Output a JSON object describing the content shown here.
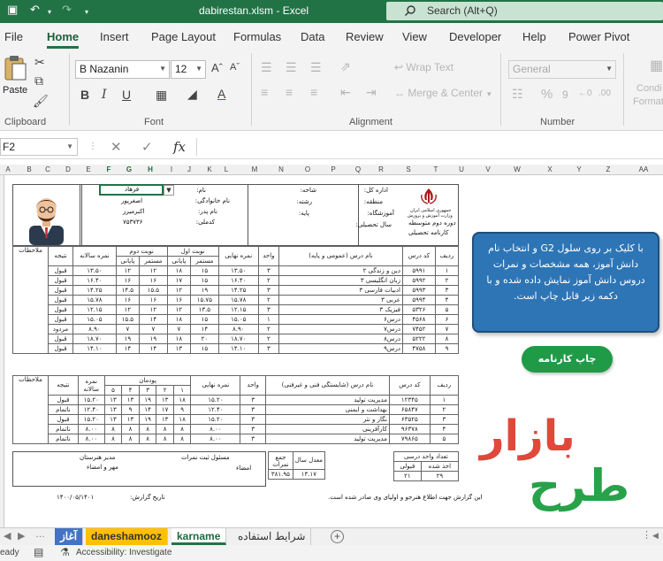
{
  "window": {
    "title": "dabirestan.xlsm  -  Excel",
    "search_text": "Search (Alt+Q)"
  },
  "menu": [
    "File",
    "Home",
    "Insert",
    "Page Layout",
    "Formulas",
    "Data",
    "Review",
    "View",
    "Developer",
    "Help",
    "Power Pivot"
  ],
  "ribbon": {
    "paste_label": "Paste",
    "clipboard_label": "Clipboard",
    "font_name": "B Nazanin",
    "font_size": "12",
    "font_label": "Font",
    "wrap_text": "Wrap Text",
    "merge_center": "Merge & Center",
    "alignment_label": "Alignment",
    "number_format": "General",
    "number_label": "Number",
    "cond_format_1": "Condi",
    "cond_format_2": "Format"
  },
  "formula_bar": {
    "name_box": "F2",
    "fx": "fx"
  },
  "columns": [
    "A",
    "B",
    "C",
    "D",
    "E",
    "F",
    "G",
    "H",
    "I",
    "J",
    "K",
    "L",
    "M",
    "N",
    "O",
    "P",
    "Q",
    "R",
    "S",
    "T",
    "U",
    "V",
    "W",
    "X",
    "Y",
    "Z",
    "AA"
  ],
  "header": {
    "emblem_line1": "جمهوری اسلامی ایران",
    "emblem_line2": "وزارت آموزش و پرورش",
    "school_stage": "دوره دوم متوسطه",
    "report_title": "کارنامه تحصیلی",
    "label_province": "اداره کل:",
    "label_region": "منطقه:",
    "label_school": "آموزشگاه:",
    "label_year": "سال تحصیلی:",
    "label_branch": "شاخه:",
    "label_field": "رشته:",
    "label_grade": "پایه:",
    "label_name": "نام:",
    "label_family": "نام خانوادگی:",
    "label_father": "نام پدر:",
    "label_code": "کدملی:",
    "student_name": "فرهاد",
    "student_family": "اصغرپور",
    "student_father": "اکبرمیرز",
    "student_code": "۷۵۳۷۳۶"
  },
  "table1": {
    "headers": {
      "row": "ردیف",
      "code": "کد درس",
      "name": "نام درس (عمومی و پایه)",
      "unit": "واحد",
      "final": "نمره نهایی",
      "term1": "نوبت اول",
      "term2": "نوبت دوم",
      "continuous": "مستمر",
      "final_exam": "پایانی",
      "yearly": "نمره سالانه",
      "result": "نتیجه",
      "notes": "ملاحظات"
    },
    "rows": [
      [
        "۱",
        "۵۹۹۱",
        "دین و زندگی ۲",
        "۳",
        "۱۳.۵۰",
        "۱۵",
        "۱۸",
        "۱۲",
        "۱۲",
        "۱۳.۵۰",
        "قبول"
      ],
      [
        "۲",
        "۵۹۹۲",
        "زبان انگلیسی ۳",
        "۲",
        "۱۶.۴۰",
        "۱۵",
        "۱۷",
        "۱۶",
        "۱۶",
        "۱۶.۴۰",
        "قبول"
      ],
      [
        "۳",
        "۵۹۹۳",
        "ادبیات فارسی ۳",
        "۳",
        "۱۴.۲۵",
        "۱۹",
        "۱۲",
        "۱۵.۵",
        "۱۴.۵",
        "۱۴.۲۵",
        "قبول"
      ],
      [
        "۴",
        "۵۹۹۴",
        "عربی ۳",
        "۲",
        "۱۵.۷۸",
        "۱۵.۷۵",
        "۱۶",
        "۱۶",
        "۱۶",
        "۱۵.۷۸",
        "قبول"
      ],
      [
        "۵",
        "۵۳۲۶",
        "فیزیک ۳",
        "۳",
        "۱۲.۱۵",
        "۱۳.۵",
        "۱۲",
        "۱۲",
        "۱۲",
        "۱۲.۱۵",
        "قبول"
      ],
      [
        "۶",
        "۴۵۶۸",
        "درس۶",
        "۱",
        "۱۵.۰۵",
        "۱۵",
        "۱۸",
        "۱۴",
        "۱۵.۵",
        "۱۵.۰۵",
        "قبول"
      ],
      [
        "۷",
        "۷۴۵۲",
        "درس۷",
        "۲",
        "۸.۹۰",
        "۱۴",
        "۷",
        "۷",
        "۷",
        "۸.۹۰",
        "مردود"
      ],
      [
        "۸",
        "۵۲۲۲",
        "درس۸",
        "۲",
        "۱۸.۷۰",
        "۲۰",
        "۱۸",
        "۱۹",
        "۱۹",
        "۱۸.۷۰",
        "قبول"
      ],
      [
        "۹",
        "۴۷۵۸",
        "درس۹",
        "۳",
        "۱۴.۱۰",
        "۱۵",
        "۱۳",
        "۱۴",
        "۱۴",
        "۱۴.۱۰",
        "قبول"
      ]
    ]
  },
  "table2": {
    "headers": {
      "row": "ردیف",
      "code": "کد درس",
      "name": "نام درس (شایستگی فنی و غیرفنی)",
      "unit": "واحد",
      "final": "نمره نهایی",
      "modules": "پودمان",
      "m1": "۱",
      "m2": "۲",
      "m3": "۳",
      "m4": "۴",
      "m5": "۵",
      "yearly": "نمره سالانه",
      "result": "نتیجه",
      "notes": "ملاحظات"
    },
    "rows": [
      [
        "۱",
        "۱۲۳۴۵",
        "مدیریت تولید",
        "۳",
        "۱۵.۲۰",
        "۱۸",
        "۱۳",
        "۱۹",
        "۱۳",
        "۱۳",
        "۱۵.۲۰",
        "قبول"
      ],
      [
        "۲",
        "۶۵۸۴۷",
        "بهداشت و ایمنی",
        "۳",
        "۱۲.۴۰",
        "۹",
        "۱۷",
        "۱۴",
        "۹",
        "۱۳",
        "۱۲.۴۰",
        "ناتمام"
      ],
      [
        "۳",
        "۶۳۵۲۵",
        "نگار و نثر",
        "۳",
        "۱۵.۲۰",
        "۱۸",
        "۱۳",
        "۱۹",
        "۱۳",
        "۱۳",
        "۱۵.۲۰",
        "قبول"
      ],
      [
        "۴",
        "۹۶۳۷۸",
        "کارآفرینی",
        "۳",
        "۸.۰۰",
        "۸",
        "۸",
        "۸",
        "۸",
        "۸",
        "۸.۰۰",
        "ناتمام"
      ],
      [
        "۵",
        "۷۹۸۶۵",
        "مدیریت تولید",
        "۳",
        "۸.۰۰",
        "۸",
        "۸",
        "۸",
        "۸",
        "۸",
        "۸.۰۰",
        "ناتمام"
      ]
    ]
  },
  "summary": {
    "units_title": "تعداد واحد درسی",
    "total": "جمع",
    "units_taken": "اخذ شده",
    "units_passed": "قبولی",
    "taken_value": "۲۹",
    "passed_value": "۲۱",
    "sum_label": "جمع نمرات",
    "sum_value": "۳۸۱.۹۵",
    "avg_label": "معدل سال",
    "avg_value": "۱۳.۱۷",
    "registrar": "مسئول ثبت نمرات",
    "signature": "امضاء",
    "principal": "مدیر هنرستان",
    "stamp": "مهر و امضاء",
    "footer_note": "این گزارش جهت اطلاع هنرجو و اولیای وی صادر شده است.",
    "date_label": "تاریخ گزارش:",
    "date_value": "۱۴۰۰/۰۵/۱۴۰۱"
  },
  "info_box": "با کلیک بر روی سلول G2 و انتخاب نام دانش آموز، همه مشخصات و نمرات دروس دانش آموز نمایش داده شده و با دکمه زیر قابل چاپ است.",
  "print_button": "چاپ کارنامه",
  "watermark": {
    "line1": "بازار",
    "line2": "طرح"
  },
  "sheet_tabs": [
    {
      "label": "آغاز",
      "color": "#4472c4",
      "text": "#ffffff"
    },
    {
      "label": "daneshamooz",
      "color": "#ffc000",
      "text": "#333333"
    },
    {
      "label": "karname",
      "color": "#ffffff",
      "text": "#1e6b3e"
    },
    {
      "label": "شرایط استفاده",
      "color": "#f0f0f0",
      "text": "#333333"
    }
  ],
  "status": {
    "ready": "eady",
    "accessibility": "Accessibility: Investigate"
  },
  "colors": {
    "excel_green": "#217346",
    "info_blue": "#2e75b6",
    "button_green": "#1f9b47"
  }
}
